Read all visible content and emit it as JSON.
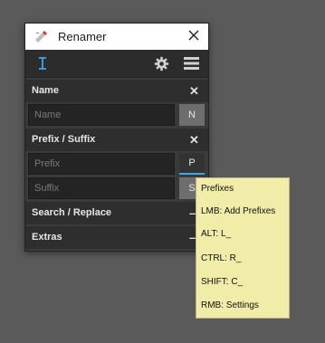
{
  "window": {
    "title": "Renamer"
  },
  "sections": {
    "name": {
      "header": "Name",
      "placeholder": "Name",
      "button": "N"
    },
    "prefix_suffix": {
      "header": "Prefix / Suffix",
      "prefix_placeholder": "Prefix",
      "prefix_button": "P",
      "suffix_placeholder": "Suffix",
      "suffix_button": "S"
    },
    "search_replace": {
      "header": "Search / Replace"
    },
    "extras": {
      "header": "Extras"
    }
  },
  "tooltip": {
    "lines": [
      "Prefixes",
      "LMB: Add Prefixes",
      "ALT: L_",
      "CTRL: R_",
      "SHIFT: C_",
      "RMB: Settings"
    ]
  },
  "icons": {
    "app": "renamer-logo-icon",
    "close": "close-icon",
    "text_cursor": "text-cursor-icon",
    "settings": "gear-icon",
    "menu": "hamburger-menu-icon",
    "section_close": "close-x-icon"
  },
  "colors": {
    "accent": "#3aa7e6",
    "tooltip_bg": "#f2eca9",
    "panel_bg": "#3a3a3a",
    "header_bg": "#2e2e2e",
    "app_icon_red": "#d9342b"
  }
}
